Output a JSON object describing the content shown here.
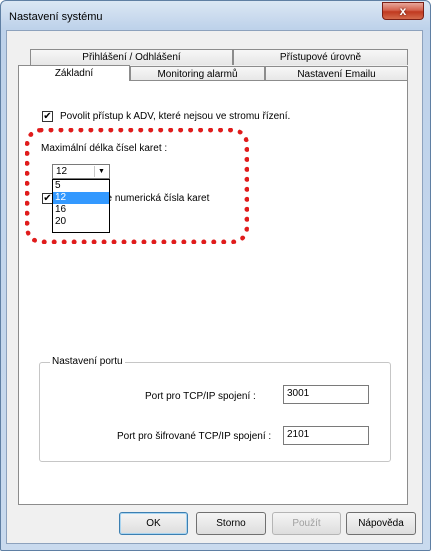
{
  "window": {
    "title": "Nastavení systému",
    "close_symbol": "x"
  },
  "tabs": {
    "row1": [
      "Přihlášení / Odhlášení",
      "Přístupové úrovně"
    ],
    "row2": [
      "Základní",
      "Monitoring alarmů",
      "Nastavení Emailu"
    ],
    "active": "Základní"
  },
  "settings": {
    "adv_access": {
      "label": "Povolit přístup k ADV, které nejsou ve stromu řízení.",
      "checked": true
    },
    "card_length": {
      "label": "Maximální délka čísel karet :",
      "value": "12",
      "options": [
        "5",
        "12",
        "16",
        "20"
      ],
      "selected": "12"
    },
    "numeric_only": {
      "label_visible": "uze numerická čísla karet",
      "checked": true
    }
  },
  "port_group": {
    "title": "Nastavení portu",
    "tcp_label": "Port pro TCP/IP spojení :",
    "tcp_value": "3001",
    "enc_label": "Port pro šifrované TCP/IP spojení :",
    "enc_value": "2101"
  },
  "buttons": {
    "ok": "OK",
    "cancel": "Storno",
    "apply": "Použít",
    "help": "Nápověda"
  },
  "colors": {
    "highlight": "#e01c1c",
    "selection": "#3399ff"
  }
}
